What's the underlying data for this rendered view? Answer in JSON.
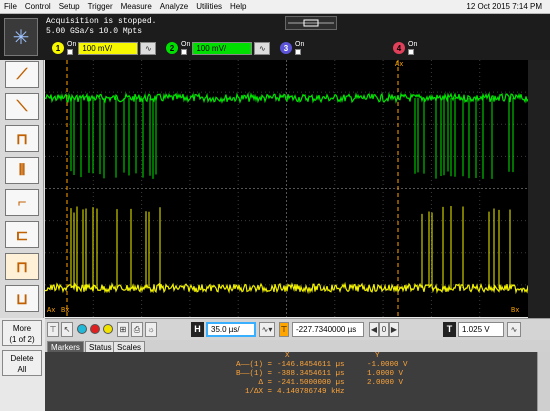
{
  "menu": {
    "items": [
      "File",
      "Control",
      "Setup",
      "Trigger",
      "Measure",
      "Analyze",
      "Utilities",
      "Help"
    ],
    "date": "12 Oct 2015  7:14 PM"
  },
  "status": {
    "line1": "Acquisition is stopped.",
    "line2": "5.00 GSa/s   10.0 Mpts"
  },
  "channels": [
    {
      "num": "1",
      "on": "On",
      "scale": "100 mV/",
      "color": "#f7f700"
    },
    {
      "num": "2",
      "on": "On",
      "scale": "100 mV/",
      "color": "#00e000"
    },
    {
      "num": "3",
      "on": "On",
      "scale": "",
      "color": "#5b54d8"
    },
    {
      "num": "4",
      "on": "On",
      "scale": "",
      "color": "#e0405a"
    }
  ],
  "left_tools": [
    "edge-trigger-icon",
    "falling-edge-icon",
    "pulse-width-icon",
    "glitch-icon",
    "runt-icon",
    "timeout-icon",
    "setup-hold-icon",
    "transition-icon"
  ],
  "more_button": {
    "line1": "More",
    "line2": "(1 of 2)"
  },
  "delete_button": {
    "line1": "Delete",
    "line2": "All"
  },
  "screen": {
    "marker_ax_top": "Ax",
    "marker_ax_bottom": "Ax",
    "marker_bx_bottom": "Bx",
    "marker_bx_right": "Bx",
    "trace_colors": {
      "ch1": "#f2f200",
      "ch2": "#00e400",
      "marker": "#ffa500"
    }
  },
  "bottombar": {
    "h_label": "H",
    "timebase": "35.0 µs/",
    "delay": "-227.7340000 µs",
    "zoom_prev": "◀",
    "zoom_value": "0",
    "zoom_next": "▶",
    "t_label": "T",
    "trigger_level": "1.025 V"
  },
  "tabs": [
    "Markers",
    "Status",
    "Scales"
  ],
  "markers": {
    "header_x": "X",
    "header_y": "Y",
    "rows": [
      {
        "name": "A——(1) =",
        "x": "-146.8454611 µs",
        "y": "-1.0000 V"
      },
      {
        "name": "B——(1) =",
        "x": "-388.3454611 µs",
        "y": "1.0000 V"
      },
      {
        "name": "Δ =",
        "x": "-241.5000000 µs",
        "y": "2.0000 V"
      },
      {
        "name": "1/ΔX =",
        "x": "4.140786749 kHz",
        "y": ""
      }
    ]
  }
}
